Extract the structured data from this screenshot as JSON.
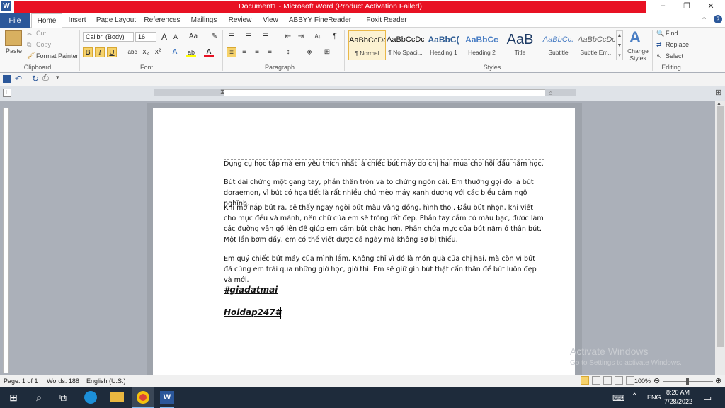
{
  "window": {
    "app_badge": "W",
    "title": "Document1 - Microsoft Word (Product Activation Failed)",
    "minimize": "–",
    "restore": "❐",
    "close": "✕"
  },
  "tabs": {
    "file": "File",
    "items": [
      "Home",
      "Insert",
      "Page Layout",
      "References",
      "Mailings",
      "Review",
      "View",
      "ABBYY FineReader 11",
      "Foxit Reader PDF"
    ]
  },
  "clipboard": {
    "paste": "Paste",
    "cut": "Cut",
    "copy": "Copy",
    "format_painter": "Format Painter",
    "group_label": "Clipboard"
  },
  "font": {
    "family": "Calibri (Body)",
    "size": "16",
    "grow": "A",
    "shrink": "A",
    "change_case": "Aa",
    "clear": "✎",
    "bold": "B",
    "italic": "I",
    "underline": "U",
    "strike": "abc",
    "subscript": "x₂",
    "superscript": "x²",
    "text_effects": "A",
    "highlight": "ab",
    "font_color": "A",
    "group_label": "Font"
  },
  "paragraph": {
    "bullets": "☰",
    "numbering": "☰",
    "multilevel": "☰",
    "decrease_indent": "⇤",
    "increase_indent": "⇥",
    "sort": "A↓",
    "show_marks": "¶",
    "align_left": "≡",
    "align_center": "≡",
    "align_right": "≡",
    "justify": "≡",
    "line_spacing": "↕",
    "shading": "◈",
    "borders": "⊞",
    "group_label": "Paragraph"
  },
  "styles": {
    "items": [
      {
        "sample": "AaBbCcDc",
        "name": "¶ Normal"
      },
      {
        "sample": "AaBbCcDc",
        "name": "¶ No Spaci..."
      },
      {
        "sample": "AaBbC(",
        "name": "Heading 1"
      },
      {
        "sample": "AaBbCc",
        "name": "Heading 2"
      },
      {
        "sample": "AaB",
        "name": "Title"
      },
      {
        "sample": "AaBbCc.",
        "name": "Subtitle"
      },
      {
        "sample": "AaBbCcDc",
        "name": "Subtle Em..."
      }
    ],
    "change_styles": "Change Styles",
    "group_label": "Styles"
  },
  "editing": {
    "find": "Find",
    "replace": "Replace",
    "select": "Select",
    "group_label": "Editing"
  },
  "document": {
    "paragraphs": [
      "Dụng cụ học tập mà em yêu thích nhất là chiếc bút máy do chị hai mua cho hồi đầu năm học.",
      "Bút dài chừng một gang tay, phần thân tròn và to chừng ngón cái. Em thường gọi đó là bút doraemon, vì bút có họa tiết là rất nhiều chú mèo máy xanh dương với các biểu cảm ngộ nghĩnh.",
      "Khi mở nắp bút ra, sẽ thấy ngay ngòi bút màu vàng đồng, hình thoi. Đầu bút nhọn, khi viết cho mực đều và mảnh, nên chữ của em sẽ trông rất đẹp. Phần tay cầm có màu bạc, được làm các đường vân gồ lên để giúp em cầm bút chắc hơn. Phần chứa mực của bút nằm ở thân bút. Một lần bơm đầy, em có thể viết được cả ngày mà không sợ bị thiếu.",
      "Em quý chiếc bút máy của mình lắm. Không chỉ vì đó là món quà của chị hai, mà còn vì bút đã cùng em trải qua những giờ học, giờ thi. Em sẽ giữ gìn bút thật cẩn thận để bút luôn đẹp và mới."
    ],
    "tag1": "#giadatmai",
    "tag2": "Hoidap247#"
  },
  "watermark": {
    "line1": "Activate Windows",
    "line2": "Go to Settings to activate Windows."
  },
  "status": {
    "page": "Page: 1 of 1",
    "words": "Words: 188",
    "language": "English (U.S.)",
    "zoom": "100%"
  },
  "taskbar": {
    "start_icon": "⊞",
    "search_icon": "⌕",
    "taskview_icon": "⧉",
    "language": "ENG",
    "time": "8:20 AM",
    "date": "7/28/2022"
  },
  "colors": {
    "word_blue": "#2b579a",
    "title_red": "#e81123",
    "taskbar": "#1e2b3b"
  }
}
